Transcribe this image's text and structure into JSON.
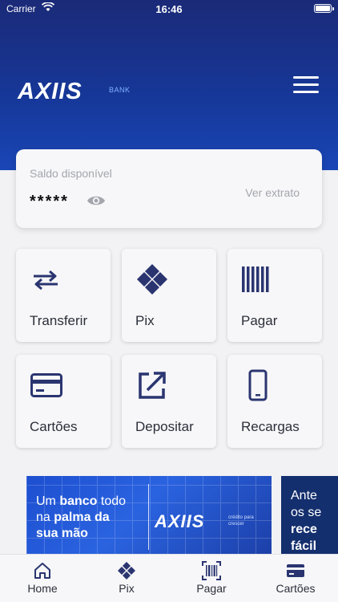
{
  "status_bar": {
    "carrier": "Carrier",
    "time": "16:46"
  },
  "header": {
    "logo_text": "AXIIS",
    "logo_sub": "BANK"
  },
  "balance": {
    "label": "Saldo disponível",
    "value": "*****",
    "statement_link": "Ver extrato"
  },
  "actions": [
    {
      "label": "Transferir",
      "icon": "transfer-icon"
    },
    {
      "label": "Pix",
      "icon": "pix-icon"
    },
    {
      "label": "Pagar",
      "icon": "barcode-icon"
    },
    {
      "label": "Cartões",
      "icon": "credit-card-icon"
    },
    {
      "label": "Depositar",
      "icon": "external-link-icon"
    },
    {
      "label": "Recargas",
      "icon": "phone-icon"
    }
  ],
  "banners": [
    {
      "line1_regular": "Um ",
      "line1_bold": "banco",
      "line1_regular2": " todo",
      "line2_regular": "na ",
      "line2_bold": "palma da",
      "line3_bold": "sua mão",
      "logo_text": "AXIIS",
      "logo_sub": "crédito para crescer"
    },
    {
      "line1": "Ante",
      "line2": "os se",
      "line3": "rece",
      "line4": "fácil"
    }
  ],
  "tabs": [
    {
      "label": "Home",
      "icon": "home-icon"
    },
    {
      "label": "Pix",
      "icon": "pix-icon"
    },
    {
      "label": "Pagar",
      "icon": "barcode-scan-icon"
    },
    {
      "label": "Cartões",
      "icon": "credit-card-icon"
    }
  ],
  "colors": {
    "brand_dark": "#1b2a78",
    "brand_blue": "#1a46b6",
    "icon_navy": "#2a3570",
    "text_muted": "#a4a6ad"
  }
}
